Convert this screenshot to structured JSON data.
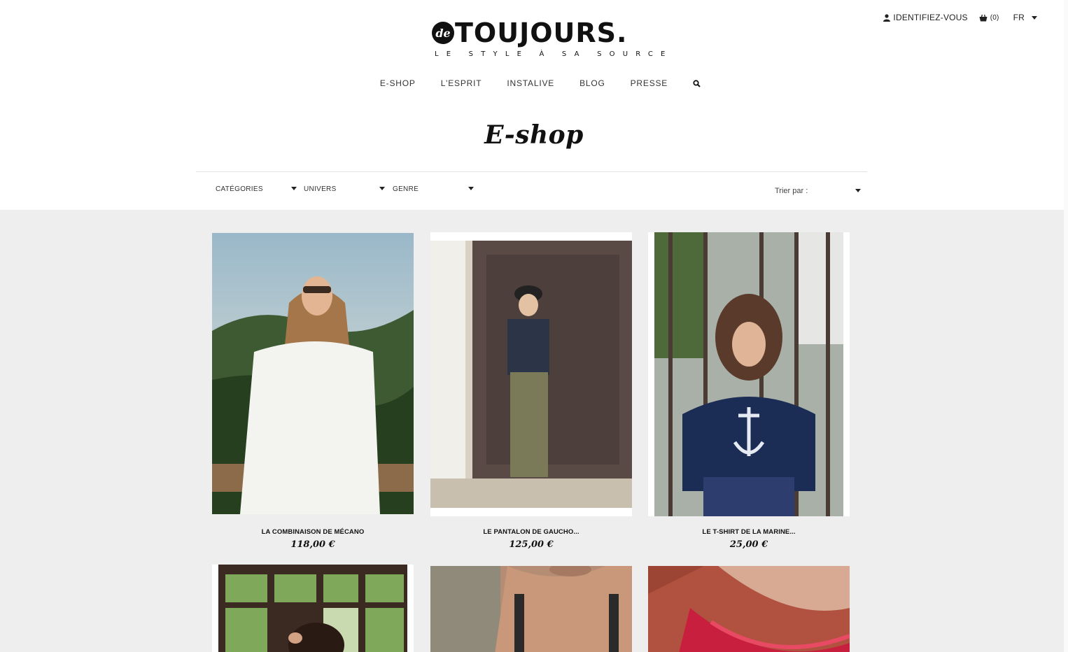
{
  "topbar": {
    "login_label": "IDENTIFIEZ-VOUS",
    "cart_count": "(0)",
    "language": "FR",
    "user_icon": "user-icon",
    "cart_icon": "basket-icon"
  },
  "brand": {
    "prefix": "de",
    "name": "TOUJOURS.",
    "tagline": "LE STYLE À SA SOURCE"
  },
  "nav": {
    "items": [
      "E-SHOP",
      "L'ESPRIT",
      "INSTALIVE",
      "BLOG",
      "PRESSE"
    ],
    "search_icon": "search-icon"
  },
  "page": {
    "title": "E-shop"
  },
  "filters": {
    "categories": "CATÉGORIES",
    "universe": "UNIVERS",
    "gender": "GENRE",
    "sort_label": "Trier par :"
  },
  "products": [
    {
      "name": "LA COMBINAISON DE MÉCANO",
      "price": "118,00 €"
    },
    {
      "name": "LE PANTALON DE GAUCHO...",
      "price": "125,00 €"
    },
    {
      "name": "LE T-SHIRT DE LA MARINE...",
      "price": "25,00 €"
    }
  ],
  "colors": {
    "text": "#222222",
    "grid_background": "#eeeeee",
    "tshirt_navy": "#1c2d55"
  }
}
